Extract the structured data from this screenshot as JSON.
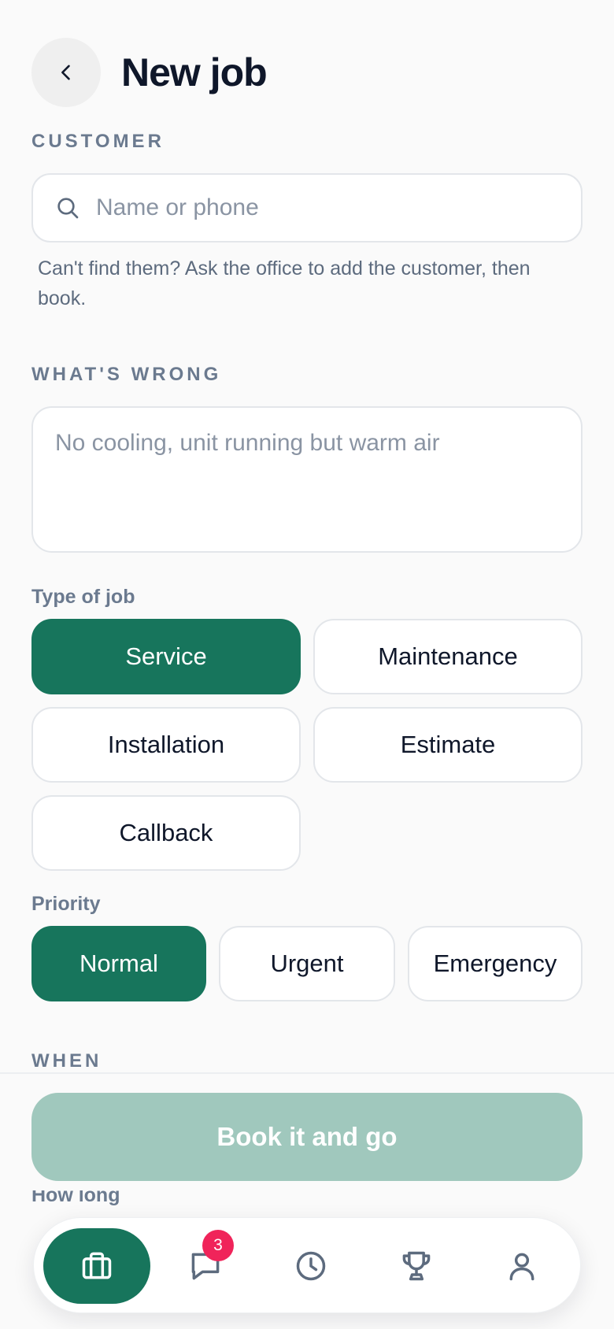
{
  "header": {
    "title": "New job"
  },
  "customer": {
    "section_label": "CUSTOMER",
    "search_placeholder": "Name or phone",
    "search_value": "",
    "helper_text": "Can't find them? Ask the office to add the customer, then book."
  },
  "problem": {
    "section_label": "WHAT'S WRONG",
    "placeholder": "No cooling, unit running but warm air",
    "value": ""
  },
  "job_type": {
    "label": "Type of job",
    "selected": "Service",
    "options": [
      "Service",
      "Maintenance",
      "Installation",
      "Estimate",
      "Callback"
    ]
  },
  "priority": {
    "label": "Priority",
    "selected": "Normal",
    "options": [
      "Normal",
      "Urgent",
      "Emergency"
    ]
  },
  "when": {
    "section_label": "WHEN"
  },
  "how_long": {
    "label": "How long"
  },
  "book_button": {
    "label": "Book it and go",
    "enabled": false
  },
  "nav": {
    "items": [
      {
        "icon": "briefcase-icon",
        "active": true
      },
      {
        "icon": "chat-icon",
        "badge": "3"
      },
      {
        "icon": "clock-icon"
      },
      {
        "icon": "trophy-icon"
      },
      {
        "icon": "user-icon"
      }
    ]
  },
  "colors": {
    "accent": "#17755c",
    "accent_disabled": "#a0c8bd",
    "badge": "#f0245a",
    "label": "#6b7a8f"
  }
}
